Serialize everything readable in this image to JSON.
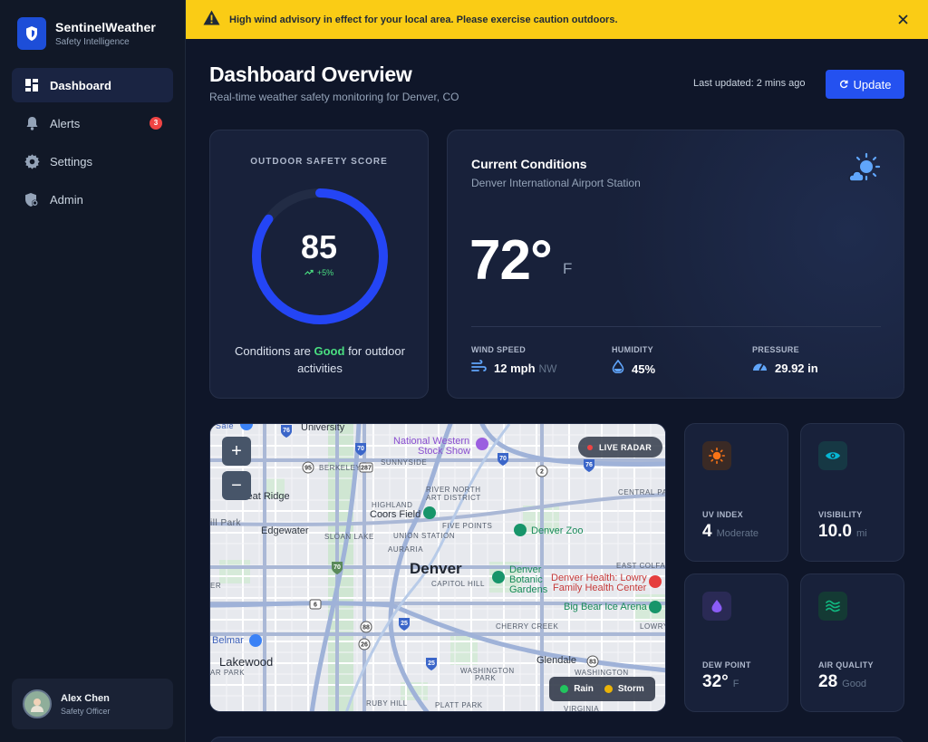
{
  "brand": {
    "name": "SentinelWeather",
    "tagline": "Safety Intelligence"
  },
  "sidebar": {
    "items": [
      {
        "label": "Dashboard",
        "icon": "dashboard-icon",
        "active": true
      },
      {
        "label": "Alerts",
        "icon": "bell-icon",
        "badge": "3"
      },
      {
        "label": "Settings",
        "icon": "gear-icon"
      },
      {
        "label": "Admin",
        "icon": "admin-shield-icon"
      }
    ]
  },
  "user": {
    "name": "Alex Chen",
    "role": "Safety Officer"
  },
  "alert": {
    "text": "High wind advisory in effect for your local area. Please exercise caution outdoors."
  },
  "header": {
    "title": "Dashboard Overview",
    "subtitle": "Real-time weather safety monitoring for Denver, CO",
    "last_updated": "Last updated: 2 mins ago",
    "update_label": "Update"
  },
  "safety": {
    "title": "OUTDOOR SAFETY SCORE",
    "score": "85",
    "score_fraction": 0.85,
    "trend": "+5%",
    "desc_prefix": "Conditions are",
    "desc_status": "Good",
    "desc_suffix": "for outdoor activities"
  },
  "conditions": {
    "title": "Current Conditions",
    "station": "Denver International Airport Station",
    "temperature": "72°",
    "unit": "F",
    "wind": {
      "label": "WIND SPEED",
      "value": "12 mph",
      "sub": "NW"
    },
    "humidity": {
      "label": "HUMIDITY",
      "value": "45%"
    },
    "pressure": {
      "label": "PRESSURE",
      "value": "29.92 in"
    }
  },
  "map": {
    "zoom_in": "+",
    "zoom_out": "−",
    "live_label": "LIVE RADAR",
    "legend": [
      {
        "label": "Rain",
        "color": "#22c55e"
      },
      {
        "label": "Storm",
        "color": "#eab308"
      }
    ],
    "labels": {
      "university": "University",
      "berkeley": "BERKELEY",
      "sunnyside": "SUNNYSIDE",
      "national_western": "National Western",
      "stock_show": "Stock Show",
      "wheat_ridge": "Wheat Ridge",
      "hill_park": "ill Park",
      "highland": "HIGHLAND",
      "river_north": "RIVER NORTH",
      "art_district": "ART DISTRICT",
      "central_park": "CENTRAL PAR",
      "coors_field": "Coors Field",
      "five_points": "FIVE POINTS",
      "edgewater": "Edgewater",
      "sloan_lake": "SLOAN LAKE",
      "union_station": "UNION STATION",
      "denver_zoo": "Denver Zoo",
      "auraria": "AURARIA",
      "denver": "Denver",
      "east_colfax": "EAST COLFAX",
      "denver_botanic_1": "Denver",
      "denver_botanic_2": "Botanic",
      "denver_botanic_3": "Gardens",
      "denver_health_1": "Denver Health: Lowry",
      "denver_health_2": "Family Health Center",
      "capitol_hill": "CAPITOL HILL",
      "big_bear": "Big Bear Ice Arena",
      "lowry": "LOWRY",
      "cherry_creek": "CHERRY CREEK",
      "belmar": "Belmar",
      "lakewood": "Lakewood",
      "glendale": "Glendale",
      "washington_park_1": "WASHINGTON",
      "washington_park_2": "PARK",
      "washington_va": "WASHINGTON",
      "ar_park": "AR PARK",
      "er": "ER",
      "ruby_hill": "RUBY HILL",
      "platt_park": "PLATT PARK",
      "virginia": "VIRGINIA",
      "sale": "Sale"
    }
  },
  "metrics": {
    "uv": {
      "label": "UV INDEX",
      "value": "4",
      "sub": "Moderate",
      "color": "#f97316"
    },
    "visibility": {
      "label": "VISIBILITY",
      "value": "10.0",
      "sub": "mi",
      "color": "#06b6d4"
    },
    "dew": {
      "label": "DEW POINT",
      "value": "32°",
      "sub": "F",
      "color": "#8b5cf6"
    },
    "air": {
      "label": "AIR QUALITY",
      "value": "28",
      "sub": "Good",
      "color": "#10b981"
    }
  },
  "colors": {
    "accent": "#2451f0",
    "alert_bg": "#facc15",
    "good": "#4ade80",
    "badge": "#ef4444"
  }
}
